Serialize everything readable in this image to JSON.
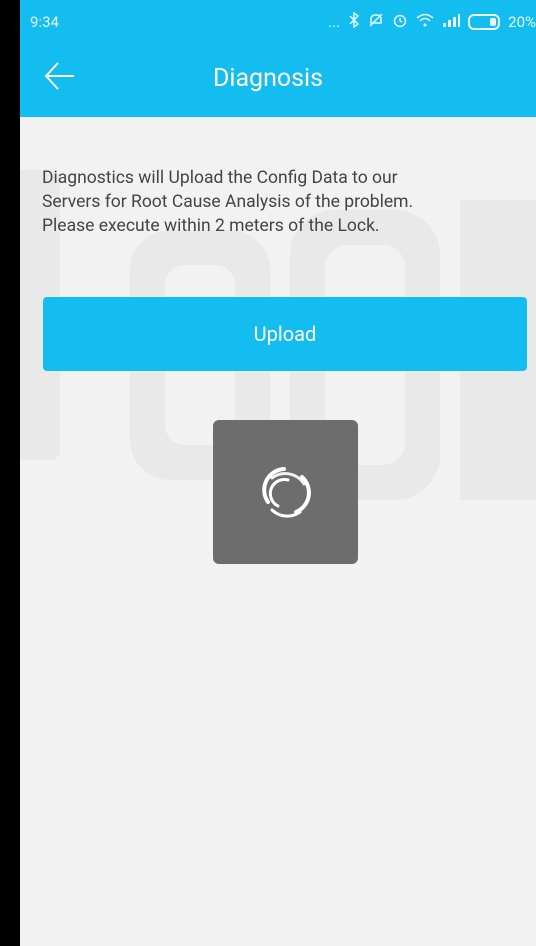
{
  "status_bar": {
    "time": "9:34",
    "dots": "...",
    "battery_text": "20%"
  },
  "header": {
    "title": "Diagnosis"
  },
  "main": {
    "description_lines": [
      "Diagnostics will Upload the Config Data to our",
      "Servers for Root Cause Analysis of the problem.",
      "Please execute within 2 meters of the Lock."
    ],
    "upload_label": "Upload"
  },
  "colors": {
    "accent": "#13bdf0",
    "background": "#f2f2f2",
    "loader": "#6d6d6d"
  },
  "icons": [
    "back-arrow-icon",
    "bluetooth-icon",
    "mute-icon",
    "alarm-icon",
    "wifi-icon",
    "signal-icon",
    "battery-icon",
    "loading-spinner-icon"
  ]
}
